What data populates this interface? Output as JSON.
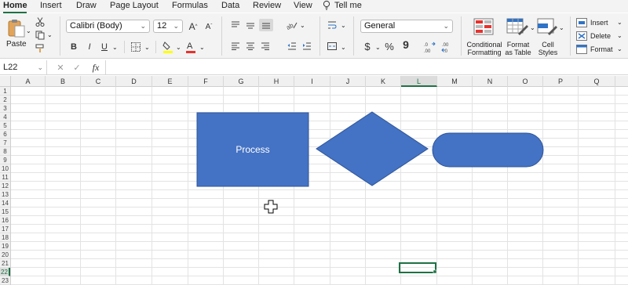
{
  "ribbon_tabs": [
    "Home",
    "Insert",
    "Draw",
    "Page Layout",
    "Formulas",
    "Data",
    "Review",
    "View"
  ],
  "tell_me": "Tell me",
  "clipboard": {
    "paste_label": "Paste"
  },
  "font": {
    "name": "Calibri (Body)",
    "size": "12",
    "bold": "B",
    "italic": "I",
    "underline": "U",
    "grow": "A",
    "shrink": "A"
  },
  "number": {
    "format": "General",
    "currency": "$",
    "percent": "%",
    "comma": "9"
  },
  "styles": {
    "conditional_formatting": [
      "Conditional",
      "Formatting"
    ],
    "format_as_table": [
      "Format",
      "as Table"
    ],
    "cell_styles": [
      "Cell",
      "Styles"
    ]
  },
  "cells_group": {
    "insert": "Insert",
    "delete": "Delete",
    "format": "Format"
  },
  "formula_bar": {
    "name_box": "L22",
    "fx": "fx",
    "value": ""
  },
  "columns": [
    "A",
    "B",
    "C",
    "D",
    "E",
    "F",
    "G",
    "H",
    "I",
    "J",
    "K",
    "L",
    "M",
    "N",
    "O",
    "P",
    "Q"
  ],
  "rows": [
    "1",
    "2",
    "3",
    "4",
    "5",
    "6",
    "7",
    "8",
    "9",
    "10",
    "11",
    "12",
    "13",
    "14",
    "15",
    "16",
    "17",
    "18",
    "19",
    "20",
    "21",
    "22",
    "23"
  ],
  "selected_cell": {
    "column": "L",
    "row": "22"
  },
  "shapes": [
    {
      "type": "rectangle",
      "text": "Process"
    },
    {
      "type": "diamond",
      "text": ""
    },
    {
      "type": "rounded-rectangle",
      "text": ""
    }
  ],
  "colors": {
    "accent": "#1e7145",
    "shape_fill": "#4472c4",
    "shape_stroke": "#2f5597",
    "font_color_bar": "#e8322d",
    "highlight_bar": "#ffff00"
  }
}
